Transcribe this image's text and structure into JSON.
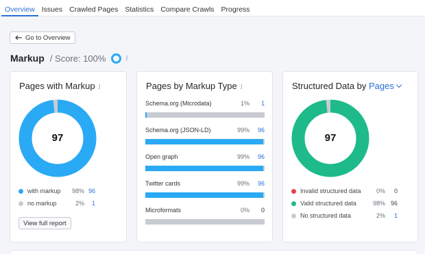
{
  "tabs": [
    {
      "label": "Overview",
      "active": true
    },
    {
      "label": "Issues",
      "active": false
    },
    {
      "label": "Crawled Pages",
      "active": false
    },
    {
      "label": "Statistics",
      "active": false
    },
    {
      "label": "Compare Crawls",
      "active": false
    },
    {
      "label": "Progress",
      "active": false
    }
  ],
  "back_button": {
    "label": "Go to Overview",
    "icon": "arrow-left-icon"
  },
  "header": {
    "title": "Markup",
    "score_label": "/ Score: 100%",
    "info": "i"
  },
  "colors": {
    "accent": "#2b6fd6",
    "blue": "#2aa9f5",
    "green": "#1fba8a",
    "red": "#e5434f",
    "gray": "#c8cbd1"
  },
  "pages_with_markup": {
    "title": "Pages with Markup",
    "info": "i",
    "center_value": "97",
    "legend": [
      {
        "label": "with markup",
        "pct": "98%",
        "count": "96",
        "color": "#2aa9f5",
        "fraction": 0.98
      },
      {
        "label": "no markup",
        "pct": "2%",
        "count": "1",
        "color": "#c8cbd1",
        "fraction": 0.02
      }
    ],
    "view_button": "View full report"
  },
  "markup_type": {
    "title": "Pages by Markup Type",
    "info": "i",
    "rows": [
      {
        "label": "Schema.org (Microdata)",
        "pct": "1%",
        "count": "1",
        "fraction": 0.01
      },
      {
        "label": "Schema.org (JSON-LD)",
        "pct": "99%",
        "count": "96",
        "fraction": 0.99
      },
      {
        "label": "Open graph",
        "pct": "99%",
        "count": "96",
        "fraction": 0.99
      },
      {
        "label": "Twitter cards",
        "pct": "99%",
        "count": "96",
        "fraction": 0.99
      },
      {
        "label": "Microformats",
        "pct": "0%",
        "count": "0",
        "fraction": 0
      }
    ]
  },
  "structured_data": {
    "title": "Structured Data by",
    "dropdown_label": "Pages",
    "center_value": "97",
    "legend": [
      {
        "label": "Invalid structured data",
        "pct": "0%",
        "count": "0",
        "color": "#e5434f",
        "fraction": 0
      },
      {
        "label": "Valid structured data",
        "pct": "98%",
        "count": "96",
        "color": "#1fba8a",
        "fraction": 0.98
      },
      {
        "label": "No structured data",
        "pct": "2%",
        "count": "1",
        "color": "#c8cbd1",
        "fraction": 0.02
      }
    ]
  }
}
